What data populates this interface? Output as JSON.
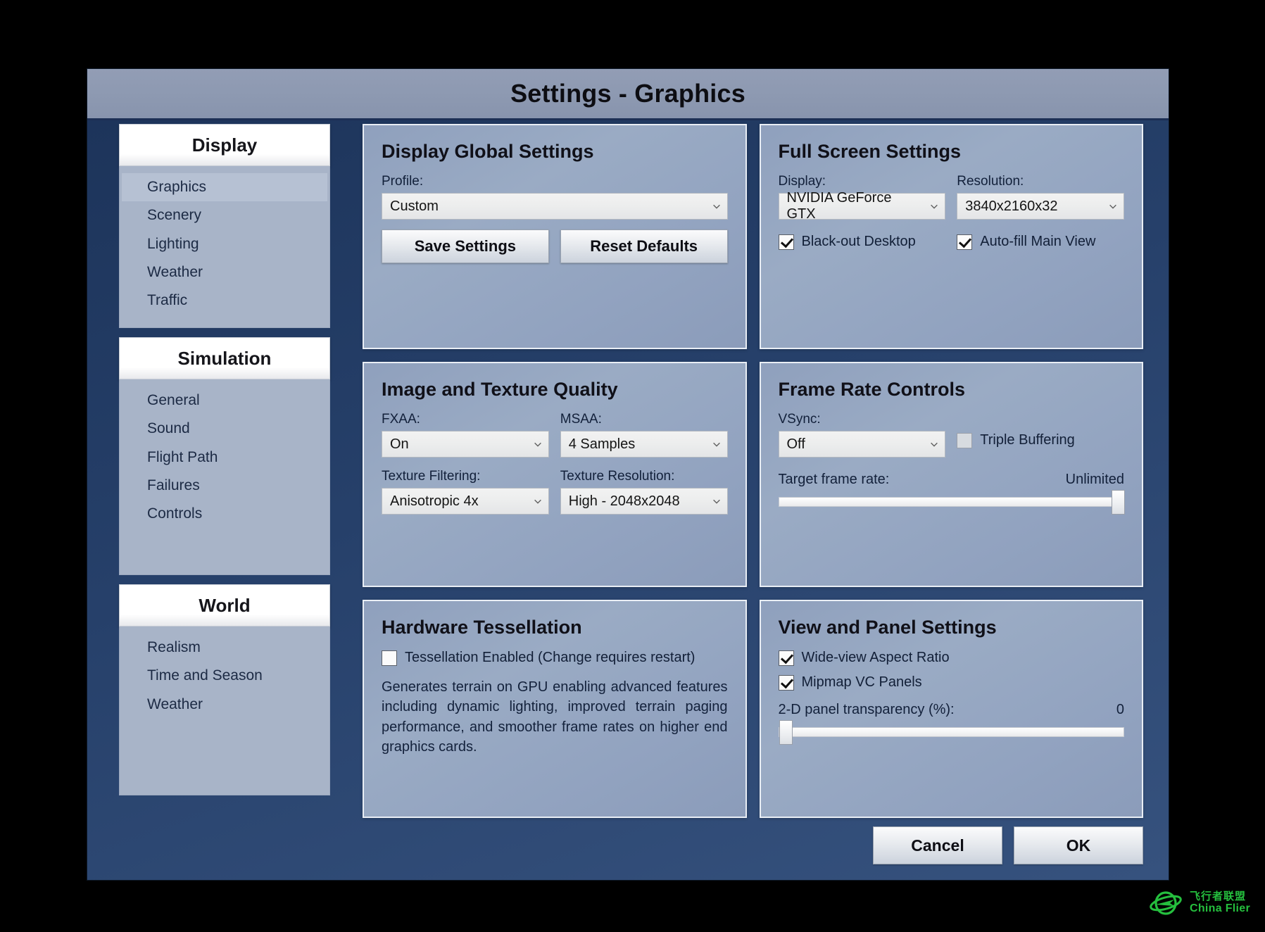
{
  "window": {
    "title": "Settings - Graphics"
  },
  "sidebar": {
    "groups": [
      {
        "header": "Display",
        "items": [
          {
            "label": "Graphics",
            "selected": true
          },
          {
            "label": "Scenery",
            "selected": false
          },
          {
            "label": "Lighting",
            "selected": false
          },
          {
            "label": "Weather",
            "selected": false
          },
          {
            "label": "Traffic",
            "selected": false
          }
        ]
      },
      {
        "header": "Simulation",
        "items": [
          {
            "label": "General",
            "selected": false
          },
          {
            "label": "Sound",
            "selected": false
          },
          {
            "label": "Flight Path",
            "selected": false
          },
          {
            "label": "Failures",
            "selected": false
          },
          {
            "label": "Controls",
            "selected": false
          }
        ]
      },
      {
        "header": "World",
        "items": [
          {
            "label": "Realism",
            "selected": false
          },
          {
            "label": "Time and Season",
            "selected": false
          },
          {
            "label": "Weather",
            "selected": false
          }
        ]
      }
    ]
  },
  "panels": {
    "display_global": {
      "title": "Display Global Settings",
      "profile_label": "Profile:",
      "profile_value": "Custom",
      "save_label": "Save Settings",
      "reset_label": "Reset Defaults"
    },
    "full_screen": {
      "title": "Full Screen Settings",
      "display_label": "Display:",
      "display_value": "NVIDIA GeForce GTX",
      "resolution_label": "Resolution:",
      "resolution_value": "3840x2160x32",
      "blackout_label": "Black-out Desktop",
      "blackout_checked": true,
      "autofill_label": "Auto-fill Main View",
      "autofill_checked": true
    },
    "image_quality": {
      "title": "Image and Texture Quality",
      "fxaa_label": "FXAA:",
      "fxaa_value": "On",
      "msaa_label": "MSAA:",
      "msaa_value": "4 Samples",
      "filtering_label": "Texture Filtering:",
      "filtering_value": "Anisotropic 4x",
      "texres_label": "Texture Resolution:",
      "texres_value": "High - 2048x2048"
    },
    "frame_rate": {
      "title": "Frame Rate Controls",
      "vsync_label": "VSync:",
      "vsync_value": "Off",
      "triple_label": "Triple Buffering",
      "triple_checked": false,
      "target_label": "Target frame rate:",
      "target_value": "Unlimited",
      "target_percent": 100
    },
    "tessellation": {
      "title": "Hardware Tessellation",
      "enabled_label": "Tessellation Enabled (Change requires restart)",
      "enabled_checked": false,
      "description": "Generates terrain on GPU enabling advanced features including dynamic lighting, improved terrain paging performance, and smoother frame rates on higher end graphics cards."
    },
    "view_panel": {
      "title": "View and Panel Settings",
      "wideview_label": "Wide-view Aspect Ratio",
      "wideview_checked": true,
      "mipmap_label": "Mipmap VC Panels",
      "mipmap_checked": true,
      "transparency_label": "2-D panel transparency (%):",
      "transparency_value": "0",
      "transparency_percent": 0
    }
  },
  "footer": {
    "cancel_label": "Cancel",
    "ok_label": "OK"
  },
  "watermark": {
    "cn": "飞行者联盟",
    "en": "China Flier",
    "color": "#25bf3e"
  }
}
